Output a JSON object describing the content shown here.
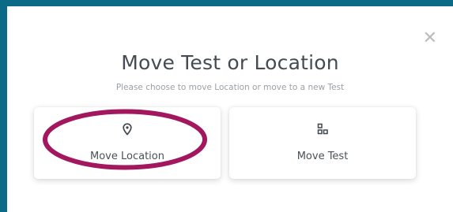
{
  "modal": {
    "title": "Move Test or Location",
    "subtitle": "Please choose to move Location or move to a new Test",
    "close_icon": "close-icon",
    "accent_color": "#0b6b87",
    "options": [
      {
        "label": "Move Location",
        "icon": "location-pin-icon"
      },
      {
        "label": "Move Test",
        "icon": "hierarchy-icon"
      }
    ]
  },
  "annotation": {
    "highlight_color": "#a3175e",
    "highlighted_option": "Move Location"
  }
}
